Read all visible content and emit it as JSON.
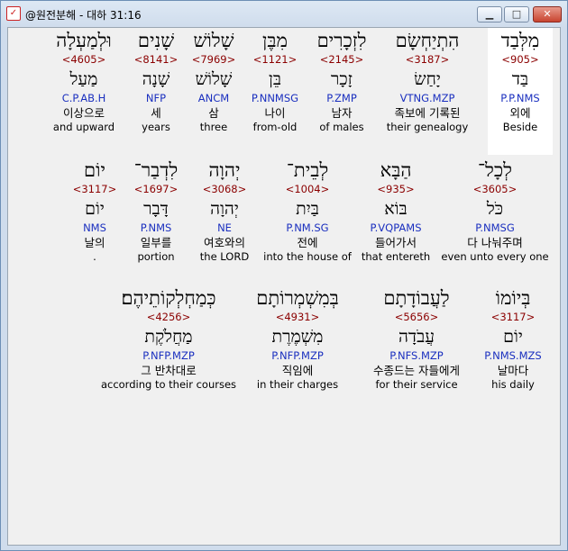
{
  "window": {
    "title": "@원전분해 - 대하 31:16",
    "app_icon": "bible-app-icon",
    "buttons": {
      "minimize": "▁",
      "maximize": "□",
      "close": "✕"
    }
  },
  "words": [
    {
      "heb": "מִלְּבַד",
      "strong": "<905>",
      "lemma": "בַּד",
      "parse": "P.P.NMS",
      "kor": "외에",
      "eng": "Beside"
    },
    {
      "heb": "הִתְיַחְשָׂם",
      "strong": "<3187>",
      "lemma": "יָחַשׂ",
      "parse": "VTNG.MZP",
      "kor": "족보에 기록된",
      "eng": "their genealogy"
    },
    {
      "heb": "לִזְכָרִים",
      "strong": "<2145>",
      "lemma": "זָכָר",
      "parse": "P.ZMP",
      "kor": "남자",
      "eng": "of males"
    },
    {
      "heb": "מִבֶּן",
      "strong": "<1121>",
      "lemma": "בֵּן",
      "parse": "P.NNMSG",
      "kor": "나이",
      "eng": "from-old"
    },
    {
      "heb": "שָׁלוֹשׁ",
      "strong": "<7969>",
      "lemma": "שָׁלוֹשׁ",
      "parse": "ANCM",
      "kor": "삼",
      "eng": "three"
    },
    {
      "heb": "שָׁנִים",
      "strong": "<8141>",
      "lemma": "שָׁנָה",
      "parse": "NFP",
      "kor": "세",
      "eng": "years"
    },
    {
      "heb": "וּלְמַעְלָה",
      "strong": "<4605>",
      "lemma": "מַעַל",
      "parse": "C.P.AB.H",
      "kor": "이상으로",
      "eng": "and upward"
    },
    {
      "heb": "לְכָל־",
      "strong": "<3605>",
      "lemma": "כֹּל",
      "parse": "P.NMSG",
      "kor": "다 나눠주며",
      "eng": "even unto every one"
    },
    {
      "heb": "הַבָּא",
      "strong": "<935>",
      "lemma": "בּוֹא",
      "parse": "P.VQPAMS",
      "kor": "들어가서",
      "eng": "that entereth"
    },
    {
      "heb": "לְבֵית־",
      "strong": "<1004>",
      "lemma": "בַּיִת",
      "parse": "P.NM.SG",
      "kor": "전에",
      "eng": "into the house of"
    },
    {
      "heb": "יְהוָה",
      "strong": "<3068>",
      "lemma": "יְהוָה",
      "parse": "NE",
      "kor": "여호와의",
      "eng": "the LORD"
    },
    {
      "heb": "לִדְבַר־",
      "strong": "<1697>",
      "lemma": "דָּבָר",
      "parse": "P.NMS",
      "kor": "일부를",
      "eng": "portion"
    },
    {
      "heb": "יוֹם",
      "strong": "<3117>",
      "lemma": "יוֹם",
      "parse": "NMS",
      "kor": "날의",
      "eng": "."
    },
    {
      "heb": "בְּיוֹמוֹ",
      "strong": "<3117>",
      "lemma": "יוֹם",
      "parse": "P.NMS.MZS",
      "kor": "날마다",
      "eng": "his daily"
    },
    {
      "heb": "לַעֲבוֹדָתָם",
      "strong": "<5656>",
      "lemma": "עֲבֹדָה",
      "parse": "P.NFS.MZP",
      "kor": "수종드는 자들에게",
      "eng": "for their service"
    },
    {
      "heb": "בְּמִשְׁמְרוֹתָם",
      "strong": "<4931>",
      "lemma": "מִשְׁמֶרֶת",
      "parse": "P.NFP.MZP",
      "kor": "직임에",
      "eng": "in their charges"
    },
    {
      "heb": "כְּמַחְלְקוֹתֵיהֶם׃",
      "strong": "<4256>",
      "lemma": "מַחֲלֹקֶת",
      "parse": "P.NFP.MZP",
      "kor": "그 반차대로",
      "eng": "according to their courses"
    }
  ]
}
